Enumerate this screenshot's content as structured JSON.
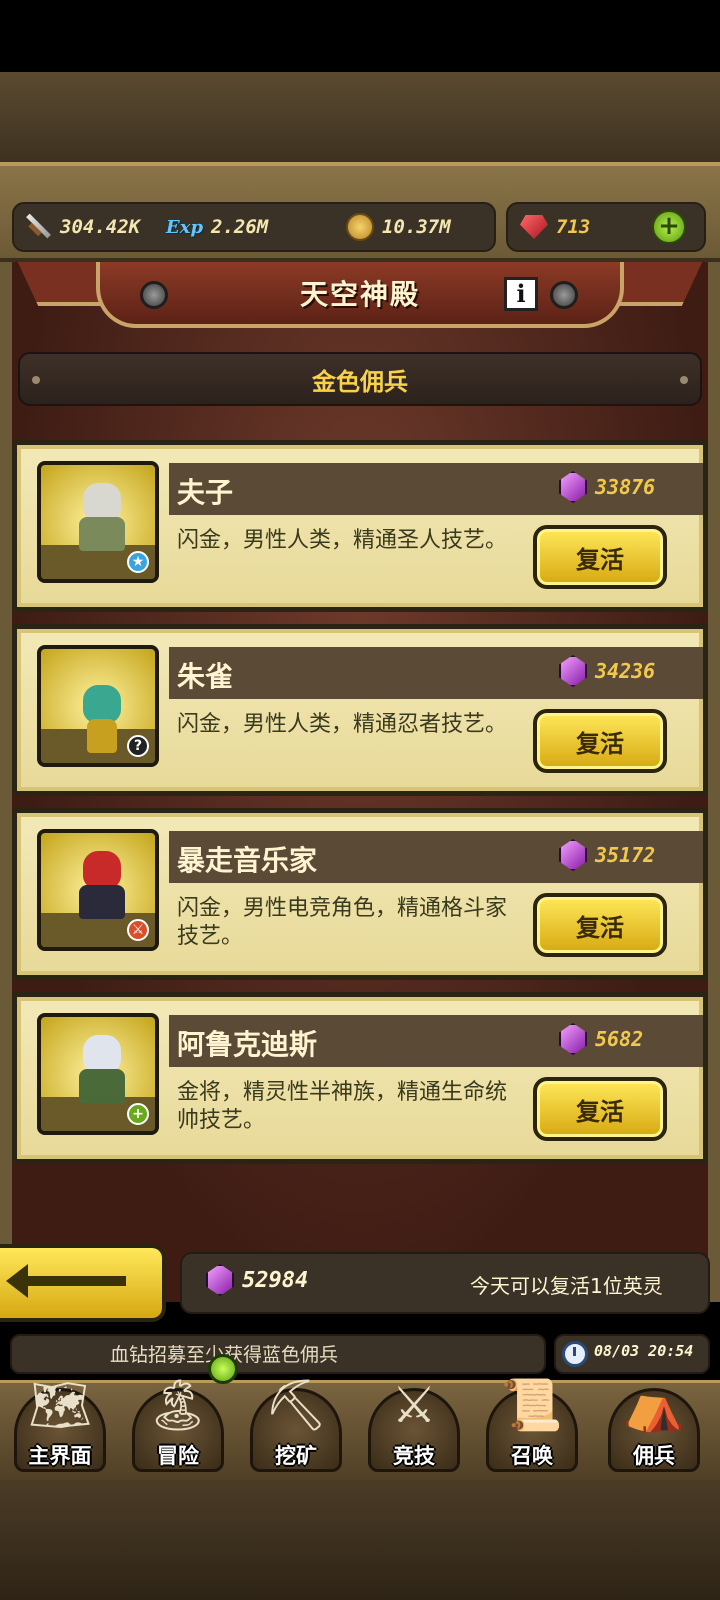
{
  "resources": {
    "attack": "304.42K",
    "exp_icon": "Exp",
    "exp": "2.26M",
    "coins": "10.37M",
    "rubies": "713"
  },
  "header": {
    "title": "天空神殿",
    "section": "金色佣兵"
  },
  "heroes": [
    {
      "name": "夫子",
      "cost": "33876",
      "desc": "闪金，男性人类，精通圣人技艺。",
      "button": "复活",
      "badge_color": "#3aa4e0",
      "badge": "★"
    },
    {
      "name": "朱雀",
      "cost": "34236",
      "desc": "闪金，男性人类，精通忍者技艺。",
      "button": "复活",
      "badge_color": "#222222",
      "badge": "?"
    },
    {
      "name": "暴走音乐家",
      "cost": "35172",
      "desc": "闪金，男性电竞角色，精通格斗家技艺。",
      "button": "复活",
      "badge_color": "#d8502a",
      "badge": "⚔"
    },
    {
      "name": "阿鲁克迪斯",
      "cost": "5682",
      "desc": "金将，精灵性半神族，精通生命统帅技艺。",
      "button": "复活",
      "badge_color": "#6aa81e",
      "badge": "+"
    }
  ],
  "footer": {
    "gems": "52984",
    "revive_info": "今天可以复活1位英灵",
    "notice": "血钻招募至少获得蓝色佣兵",
    "datetime": "08/03 20:54"
  },
  "nav": [
    {
      "label": "主界面",
      "icon": "map-scroll-icon",
      "glyph": "🗺"
    },
    {
      "label": "冒险",
      "icon": "island-icon",
      "glyph": "🏝"
    },
    {
      "label": "挖矿",
      "icon": "pickaxe-icon",
      "glyph": "⛏"
    },
    {
      "label": "竞技",
      "icon": "crossed-swords-icon",
      "glyph": "⚔"
    },
    {
      "label": "召唤",
      "icon": "summon-scroll-icon",
      "glyph": "📜"
    },
    {
      "label": "佣兵",
      "icon": "tent-icon",
      "glyph": "⛺"
    }
  ]
}
